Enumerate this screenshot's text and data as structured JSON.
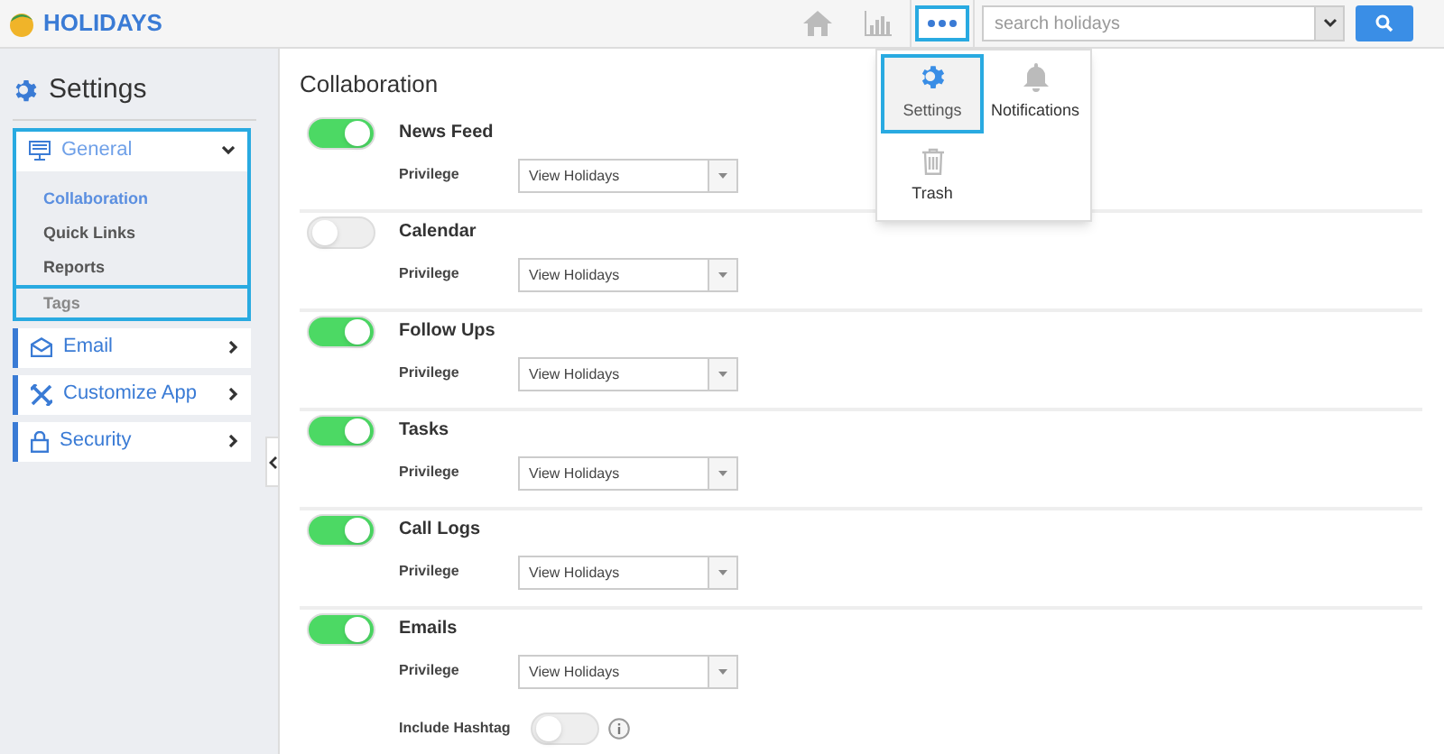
{
  "app": {
    "name": "HOLIDAYS"
  },
  "search": {
    "placeholder": "search holidays"
  },
  "more_menu": {
    "items": [
      {
        "kind": "settings",
        "label": "Settings",
        "selected": true
      },
      {
        "kind": "notifications",
        "label": "Notifications",
        "selected": false
      },
      {
        "kind": "trash",
        "label": "Trash",
        "selected": false
      }
    ]
  },
  "sidebar": {
    "title": "Settings",
    "sections": [
      {
        "kind": "general",
        "label": "General",
        "expanded": true,
        "children": [
          {
            "label": "Collaboration",
            "selected": true
          },
          {
            "label": "Quick Links",
            "selected": false
          },
          {
            "label": "Reports",
            "selected": false
          },
          {
            "label": "Tags",
            "selected": false
          }
        ]
      },
      {
        "kind": "email",
        "label": "Email",
        "expanded": false
      },
      {
        "kind": "customize",
        "label": "Customize App",
        "expanded": false
      },
      {
        "kind": "security",
        "label": "Security",
        "expanded": false
      }
    ]
  },
  "content": {
    "title": "Collaboration",
    "modules": [
      {
        "name": "News Feed",
        "on": true,
        "privilege_label": "Privilege",
        "privilege": "View Holidays"
      },
      {
        "name": "Calendar",
        "on": false,
        "privilege_label": "Privilege",
        "privilege": "View Holidays"
      },
      {
        "name": "Follow Ups",
        "on": true,
        "privilege_label": "Privilege",
        "privilege": "View Holidays"
      },
      {
        "name": "Tasks",
        "on": true,
        "privilege_label": "Privilege",
        "privilege": "View Holidays"
      },
      {
        "name": "Call Logs",
        "on": true,
        "privilege_label": "Privilege",
        "privilege": "View Holidays"
      },
      {
        "name": "Emails",
        "on": true,
        "privilege_label": "Privilege",
        "privilege": "View Holidays",
        "extra": {
          "label": "Include Hashtag",
          "on": false
        }
      }
    ]
  }
}
